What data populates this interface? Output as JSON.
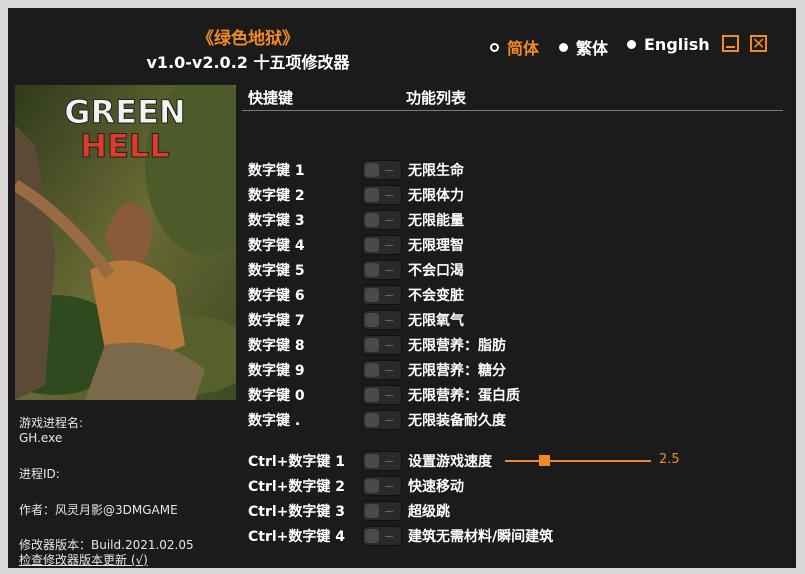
{
  "header": {
    "title": "《绿色地狱》",
    "subtitle": "v1.0-v2.0.2 十五项修改器"
  },
  "languages": [
    {
      "label": "简体",
      "selected": true
    },
    {
      "label": "繁体",
      "selected": false
    },
    {
      "label": "English",
      "selected": false
    }
  ],
  "window_buttons": {
    "minimize": "minimize-icon",
    "close_glyph": "✕"
  },
  "cover": {
    "logo_line1": "GREEN",
    "logo_line2": "HELL"
  },
  "info": {
    "process_name_label": "游戏进程名:",
    "process_name": "GH.exe",
    "process_id_label": "进程ID:",
    "author": "作者：风灵月影@3DMGAME",
    "version": "修改器版本：Build.2021.02.05",
    "update_link": "检查修改器版本更新 (√)"
  },
  "columns": {
    "hotkey": "快捷键",
    "function": "功能列表"
  },
  "cheats": [
    {
      "key": "数字键 1",
      "label": "无限生命"
    },
    {
      "key": "数字键 2",
      "label": "无限体力"
    },
    {
      "key": "数字键 3",
      "label": "无限能量"
    },
    {
      "key": "数字键 4",
      "label": "无限理智"
    },
    {
      "key": "数字键 5",
      "label": "不会口渴"
    },
    {
      "key": "数字键 6",
      "label": "不会变脏"
    },
    {
      "key": "数字键 7",
      "label": "无限氧气"
    },
    {
      "key": "数字键 8",
      "label": "无限营养：脂肪"
    },
    {
      "key": "数字键 9",
      "label": "无限营养：糖分"
    },
    {
      "key": "数字键 0",
      "label": "无限营养：蛋白质"
    },
    {
      "key": "数字键 .",
      "label": "无限装备耐久度"
    },
    {
      "key": "Ctrl+数字键 1",
      "label": "设置游戏速度"
    },
    {
      "key": "Ctrl+数字键 2",
      "label": "快速移动"
    },
    {
      "key": "Ctrl+数字键 3",
      "label": "超级跳"
    },
    {
      "key": "Ctrl+数字键 4",
      "label": "建筑无需材料/瞬间建筑"
    }
  ],
  "speed": {
    "value": "2.5",
    "fraction": 0.27
  },
  "colors": {
    "accent": "#f08a24",
    "background": "#1b1b1b"
  }
}
